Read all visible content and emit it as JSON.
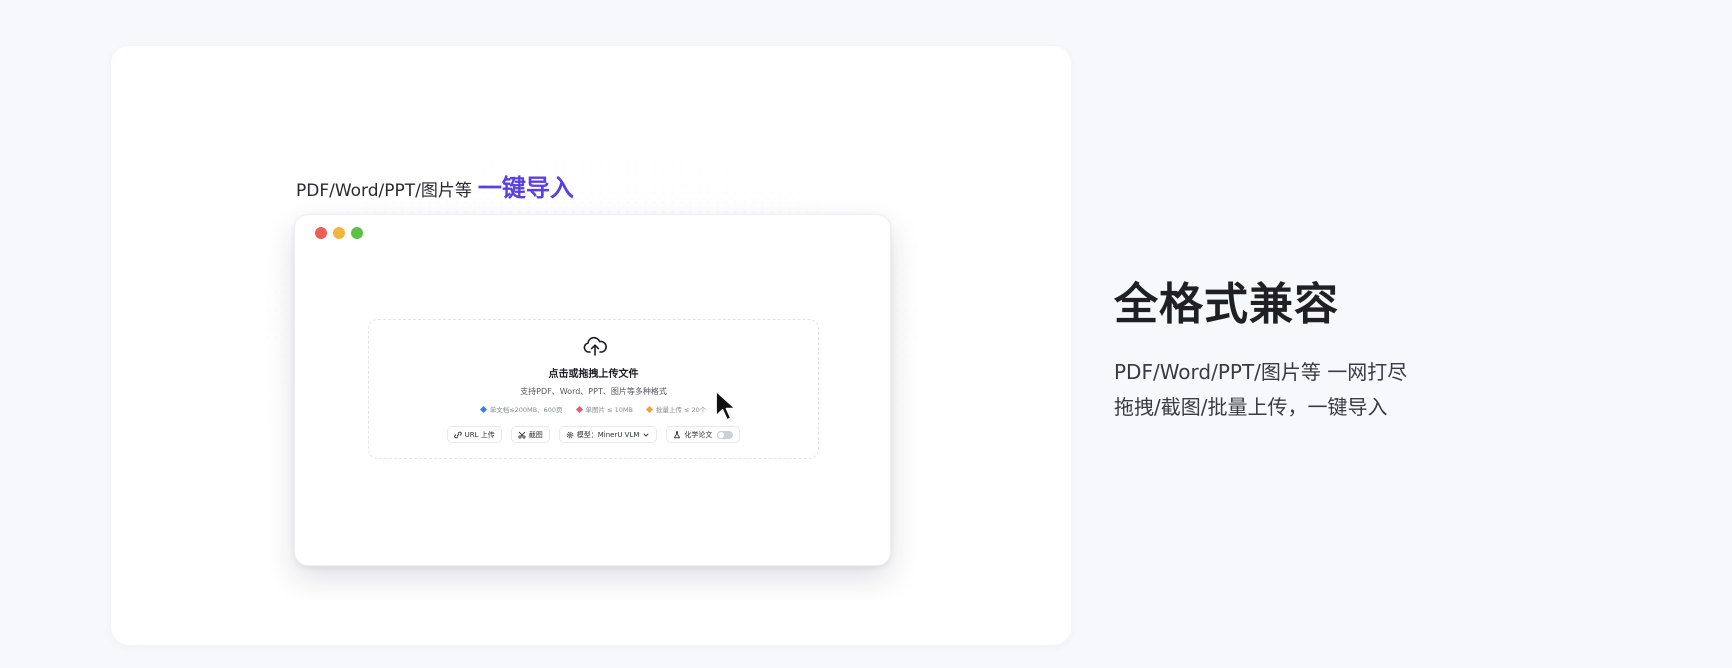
{
  "left_panel": {
    "headline_lead": "PDF/Word/PPT/图片等",
    "headline_accent": "一键导入",
    "accent_color": "#5b3fe0"
  },
  "window": {
    "traffic_lights": [
      "#ec5f57",
      "#f3b63c",
      "#5cc146"
    ],
    "dropzone": {
      "icon": "cloud-upload-icon",
      "title": "点击或拖拽上传文件",
      "subtitle": "支持PDF、Word、PPT、图片等多种格式",
      "limits": [
        {
          "text": "单文档≤200MB、600页",
          "color": "#3b7be6"
        },
        {
          "text": "单图片 ≤ 10MB",
          "color": "#e8587a"
        },
        {
          "text": "批量上传 ≤ 20个",
          "color": "#f0a23a"
        }
      ],
      "controls": {
        "url_upload": "URL 上传",
        "screenshot": "截图",
        "model_label": "模型：MinerU VLM",
        "chem_label": "化学论文"
      }
    }
  },
  "right_panel": {
    "title": "全格式兼容",
    "line1": "PDF/Word/PPT/图片等 一网打尽",
    "line2": "拖拽/截图/批量上传，一键导入"
  }
}
